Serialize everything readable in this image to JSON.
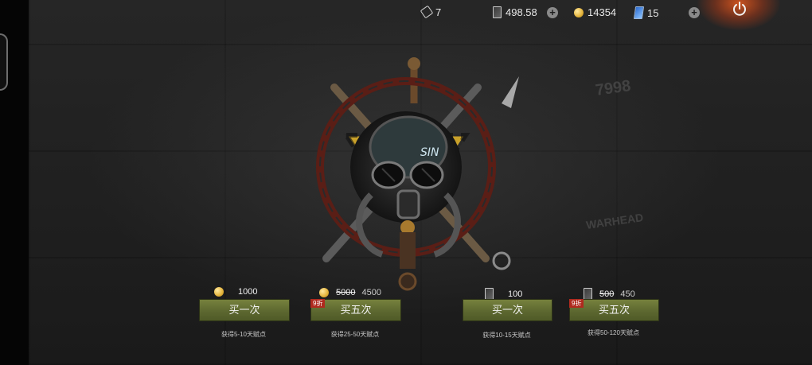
{
  "top_bar": {
    "tickets": "7",
    "card_balance": "498.58",
    "gold": "14354",
    "gems": "15",
    "plus_symbol": "+"
  },
  "wall": {
    "text_1": "7998",
    "text_2": "WARHEAD"
  },
  "offers": [
    {
      "price": "1000",
      "button": "买一次",
      "caption": "获得5-10天赋点"
    },
    {
      "badge": "9折",
      "original": "5000",
      "price": "4500",
      "button": "买五次",
      "caption": "获得25-50天赋点"
    },
    {
      "price": "100",
      "button": "买一次",
      "caption": "获得10-15天赋点"
    },
    {
      "badge": "9折",
      "original": "500",
      "price": "450",
      "button": "买五次",
      "caption": "获得50-120天赋点"
    }
  ],
  "colors": {
    "button": "#5d6830",
    "badge": "#b02a1e",
    "power_glow": "#e65a1e"
  },
  "icons": [
    "ticket-icon",
    "card-icon",
    "gold-coin-icon",
    "gem-card-icon",
    "power-icon",
    "gas-mask-emblem"
  ]
}
